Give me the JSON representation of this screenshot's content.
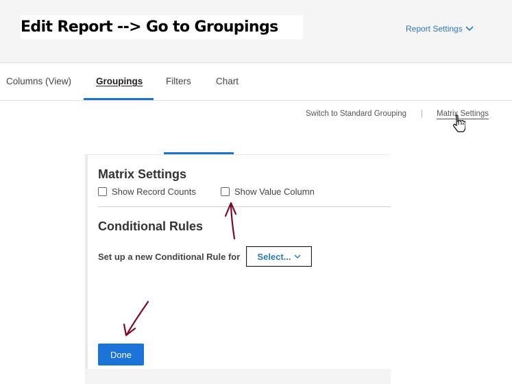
{
  "caption": {
    "text": "Edit Report --> Go to Groupings"
  },
  "header": {
    "report_settings_label": "Report Settings"
  },
  "tabs": [
    {
      "label": "Columns (View)",
      "active": false
    },
    {
      "label": "Groupings",
      "active": true
    },
    {
      "label": "Filters",
      "active": false
    },
    {
      "label": "Chart",
      "active": false
    }
  ],
  "grouping_links": {
    "standard": "Switch to Standard Grouping",
    "separator": "|",
    "matrix": "Matrix Settings"
  },
  "matrix_settings": {
    "title": "Matrix Settings",
    "show_record_counts": {
      "label": "Show Record Counts",
      "checked": false
    },
    "show_value_column": {
      "label": "Show Value Column",
      "checked": false
    }
  },
  "conditional_rules": {
    "title": "Conditional Rules",
    "setup_label": "Set up a new Conditional Rule for",
    "select_label": "Select..."
  },
  "actions": {
    "done_label": "Done"
  },
  "colors": {
    "accent": "#1a73d8",
    "link": "#2e7ab8",
    "annotation": "#7a0a2a"
  }
}
